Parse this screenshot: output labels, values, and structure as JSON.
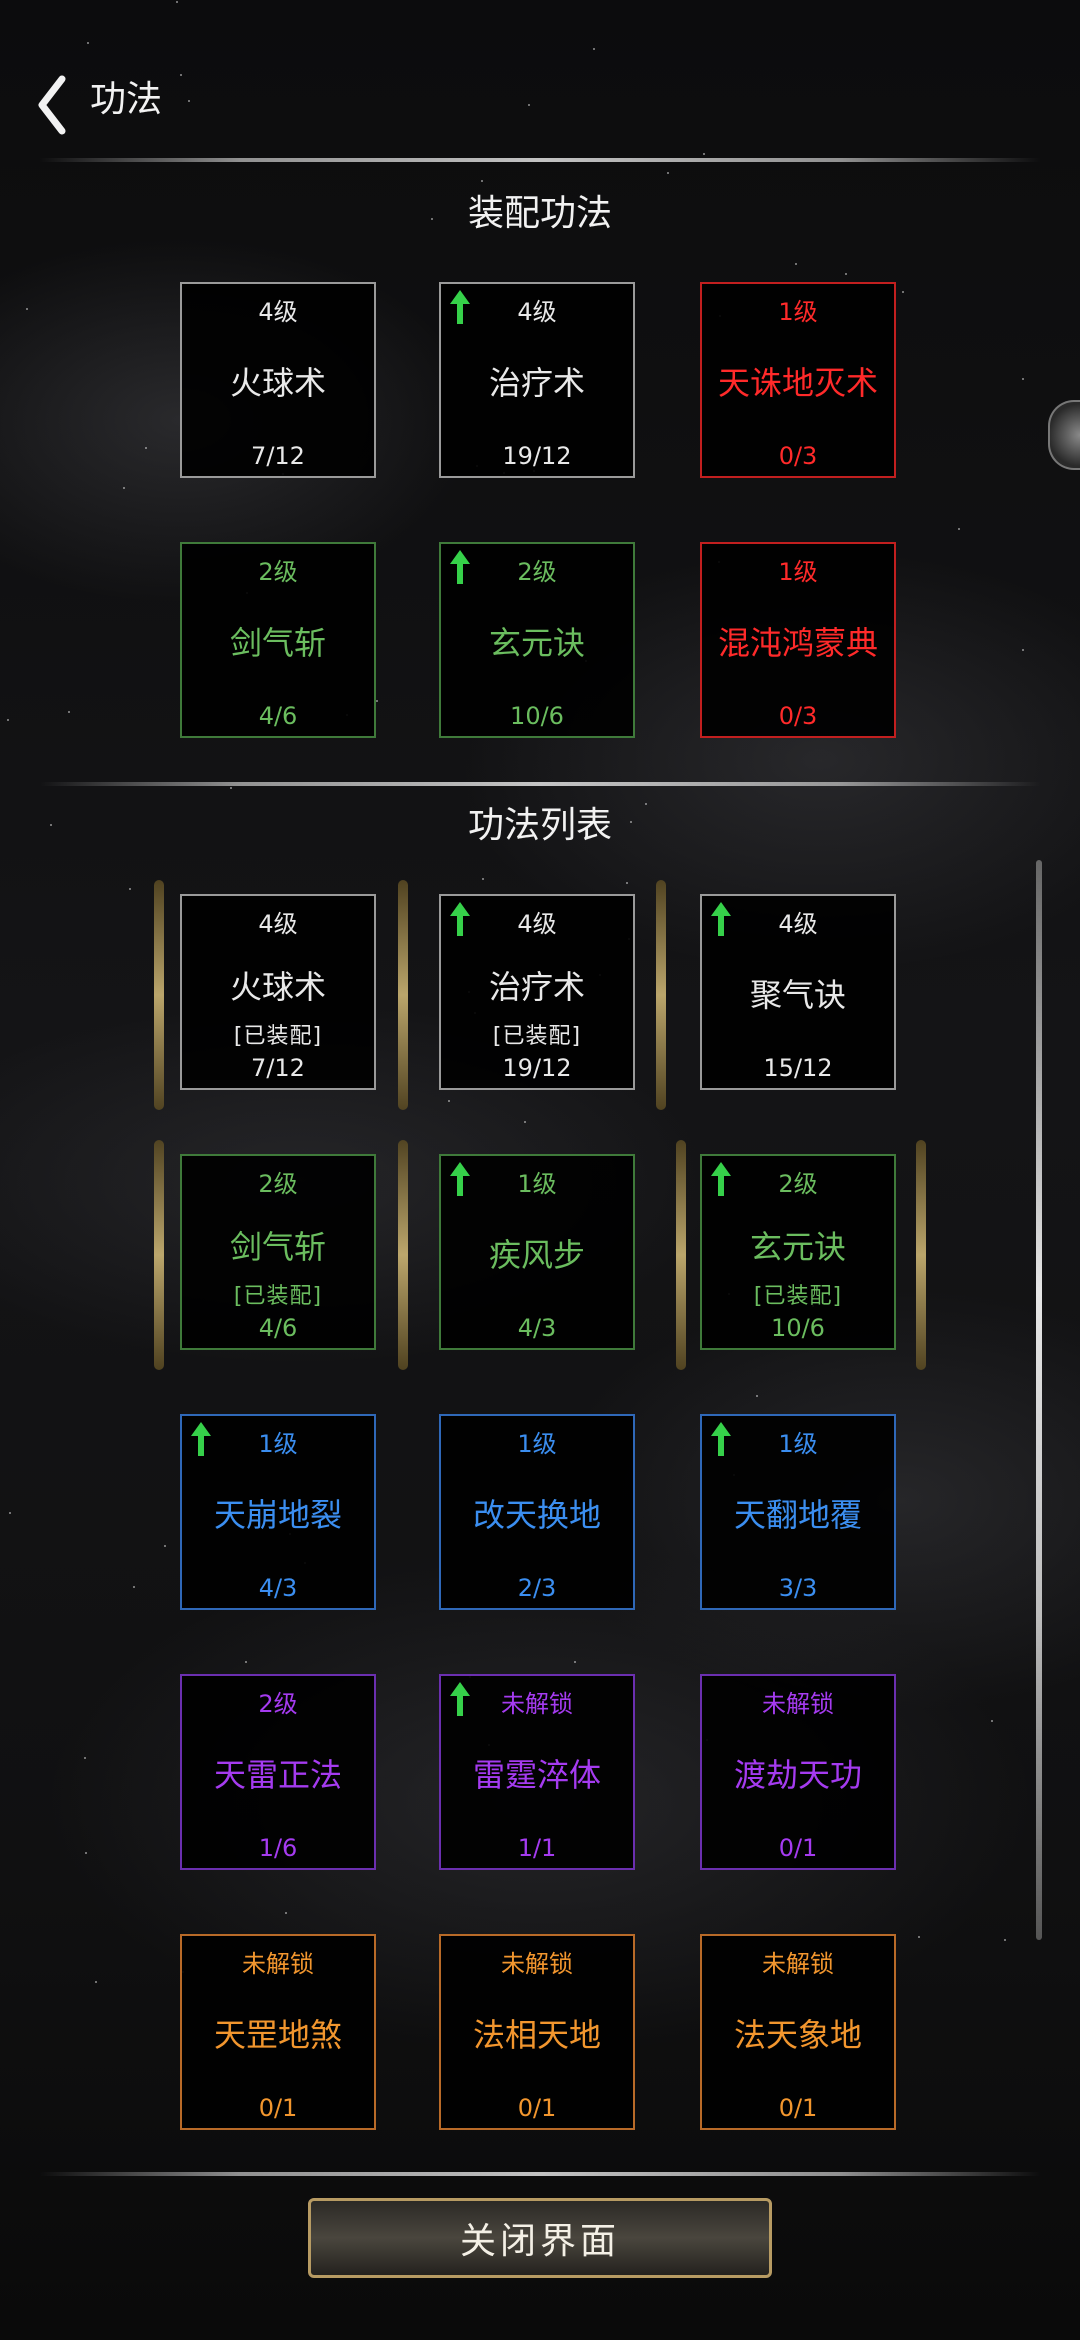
{
  "header": {
    "title": "功法",
    "back_icon": "chevron-left-icon"
  },
  "equipped_section": {
    "title": "装配功法",
    "skills": [
      {
        "level": "4级",
        "name": "火球术",
        "progress": "7/12",
        "color": "white",
        "upgradable": false
      },
      {
        "level": "4级",
        "name": "治疗术",
        "progress": "19/12",
        "color": "white",
        "upgradable": true
      },
      {
        "level": "1级",
        "name": "天诛地灭术",
        "progress": "0/3",
        "color": "red",
        "upgradable": false
      },
      {
        "level": "2级",
        "name": "剑气斩",
        "progress": "4/6",
        "color": "green",
        "upgradable": false
      },
      {
        "level": "2级",
        "name": "玄元诀",
        "progress": "10/6",
        "color": "green",
        "upgradable": true
      },
      {
        "level": "1级",
        "name": "混沌鸿蒙典",
        "progress": "0/3",
        "color": "red",
        "upgradable": false
      }
    ]
  },
  "list_section": {
    "title": "功法列表",
    "equipped_label": "[已装配]",
    "skills": [
      {
        "level": "4级",
        "name": "火球术",
        "progress": "7/12",
        "color": "white",
        "upgradable": false,
        "equipped": true
      },
      {
        "level": "4级",
        "name": "治疗术",
        "progress": "19/12",
        "color": "white",
        "upgradable": true,
        "equipped": true
      },
      {
        "level": "4级",
        "name": "聚气诀",
        "progress": "15/12",
        "color": "white",
        "upgradable": true,
        "equipped": false
      },
      {
        "level": "2级",
        "name": "剑气斩",
        "progress": "4/6",
        "color": "green",
        "upgradable": false,
        "equipped": true
      },
      {
        "level": "1级",
        "name": "疾风步",
        "progress": "4/3",
        "color": "green",
        "upgradable": true,
        "equipped": false
      },
      {
        "level": "2级",
        "name": "玄元诀",
        "progress": "10/6",
        "color": "green",
        "upgradable": true,
        "equipped": true
      },
      {
        "level": "1级",
        "name": "天崩地裂",
        "progress": "4/3",
        "color": "blue",
        "upgradable": true,
        "equipped": false
      },
      {
        "level": "1级",
        "name": "改天换地",
        "progress": "2/3",
        "color": "blue",
        "upgradable": false,
        "equipped": false
      },
      {
        "level": "1级",
        "name": "天翻地覆",
        "progress": "3/3",
        "color": "blue",
        "upgradable": true,
        "equipped": false
      },
      {
        "level": "2级",
        "name": "天雷正法",
        "progress": "1/6",
        "color": "purple",
        "upgradable": false,
        "equipped": false
      },
      {
        "level": "未解锁",
        "name": "雷霆淬体",
        "progress": "1/1",
        "color": "purple",
        "upgradable": true,
        "equipped": false
      },
      {
        "level": "未解锁",
        "name": "渡劫天功",
        "progress": "0/1",
        "color": "purple",
        "upgradable": false,
        "equipped": false
      },
      {
        "level": "未解锁",
        "name": "天罡地煞",
        "progress": "0/1",
        "color": "orange",
        "upgradable": false,
        "equipped": false
      },
      {
        "level": "未解锁",
        "name": "法相天地",
        "progress": "0/1",
        "color": "orange",
        "upgradable": false,
        "equipped": false
      },
      {
        "level": "未解锁",
        "name": "法天象地",
        "progress": "0/1",
        "color": "orange",
        "upgradable": false,
        "equipped": false
      }
    ]
  },
  "footer": {
    "close_label": "关闭界面"
  },
  "colors": {
    "white": "#e9e9e9",
    "green": "#6bbd5f",
    "red": "#ff2a2a",
    "blue": "#3b8ef0",
    "purple": "#a53bf0",
    "orange": "#f2962e",
    "upgrade_arrow": "#36d14a",
    "gold": "#b79b63"
  }
}
